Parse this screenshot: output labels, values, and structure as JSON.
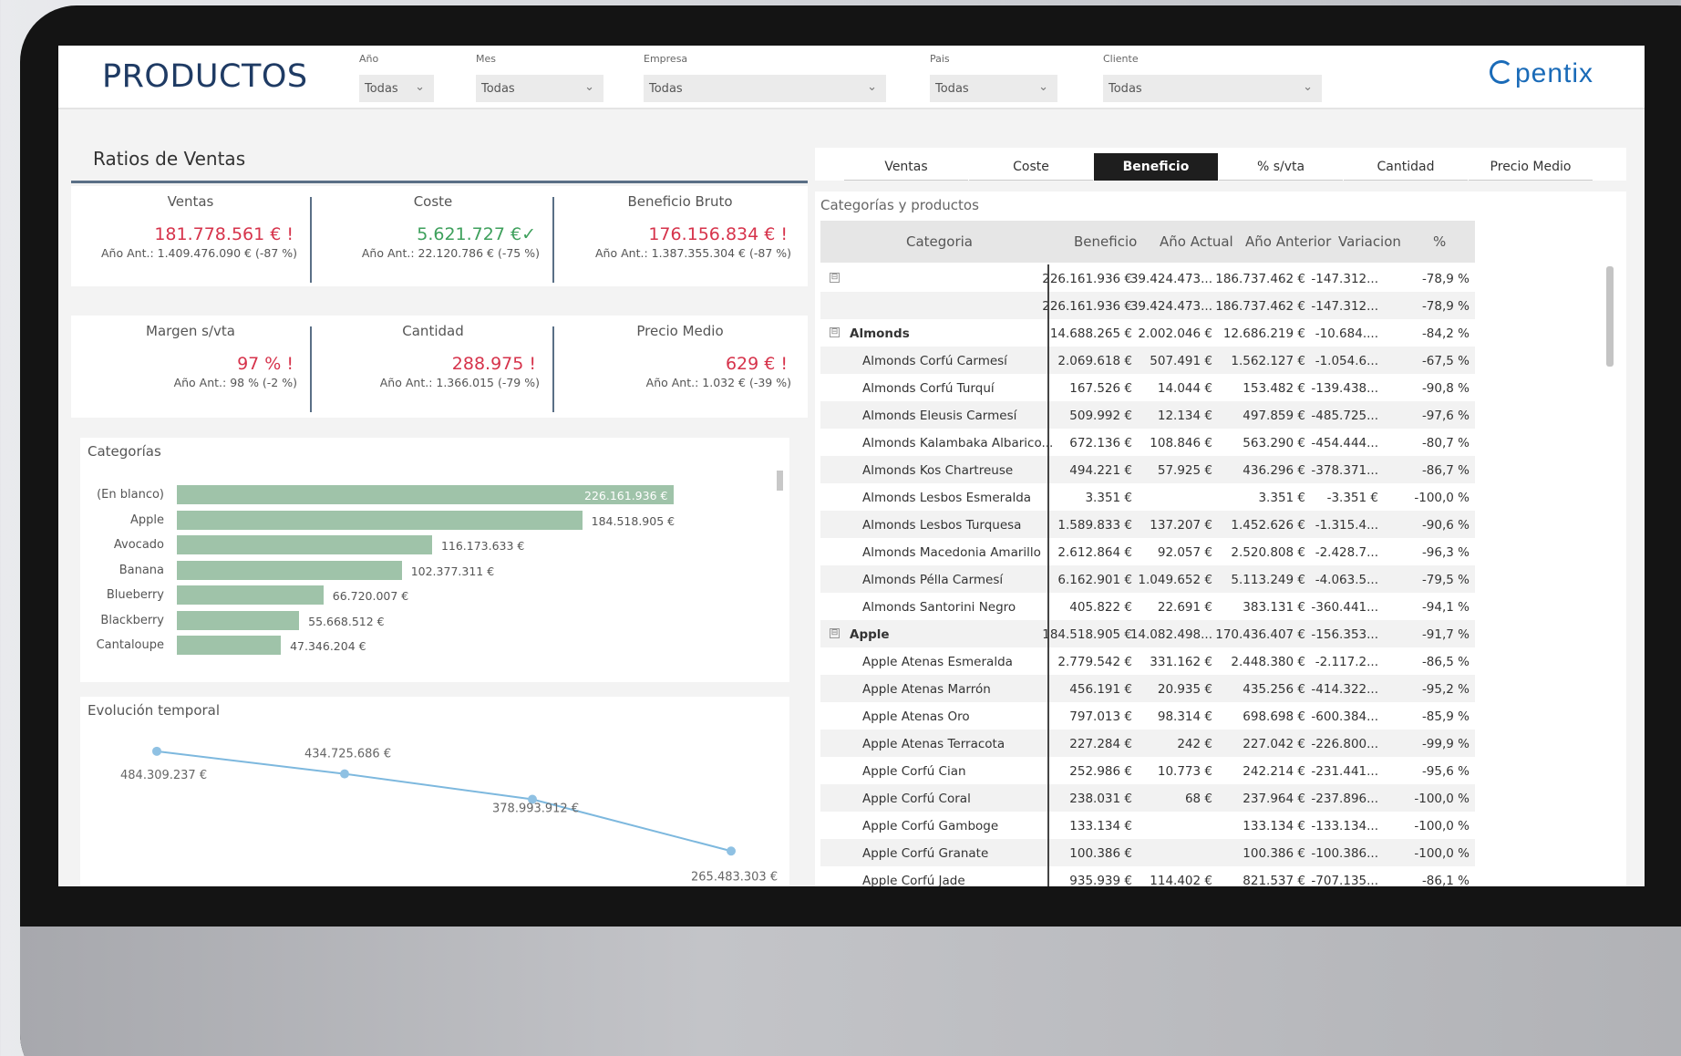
{
  "header": {
    "title": "PRODUCTOS",
    "logo_text": "pentix",
    "filters": [
      {
        "label": "Año",
        "value": "Todas"
      },
      {
        "label": "Mes",
        "value": "Todas"
      },
      {
        "label": "Empresa",
        "value": "Todas"
      },
      {
        "label": "Pais",
        "value": "Todas"
      },
      {
        "label": "Cliente",
        "value": "Todas"
      }
    ]
  },
  "ratios": {
    "title": "Ratios de Ventas",
    "row1": [
      {
        "label": "Ventas",
        "value": "181.778.561 € !",
        "sub": "Año Ant.: 1.409.476.090 € (-87 %)",
        "status": "red"
      },
      {
        "label": "Coste",
        "value": "5.621.727 €✓",
        "sub": "Año Ant.: 22.120.786 € (-75 %)",
        "status": "green"
      },
      {
        "label": "Beneficio Bruto",
        "value": "176.156.834 € !",
        "sub": "Año Ant.: 1.387.355.304 € (-87 %)",
        "status": "red"
      }
    ],
    "row2": [
      {
        "label": "Margen s/vta",
        "value": "97 % !",
        "sub": "Año Ant.: 98 % (-2 %)",
        "status": "red"
      },
      {
        "label": "Cantidad",
        "value": "288.975 !",
        "sub": "Año Ant.: 1.366.015 (-79 %)",
        "status": "red"
      },
      {
        "label": "Precio Medio",
        "value": "629 € !",
        "sub": "Año Ant.: 1.032 € (-39 %)",
        "status": "red"
      }
    ]
  },
  "categorias_card": {
    "title": "Categorías"
  },
  "evolucion_card": {
    "title": "Evolución temporal"
  },
  "chart_data": [
    {
      "type": "bar",
      "title": "Categorías",
      "orientation": "horizontal",
      "categories": [
        "(En blanco)",
        "Apple",
        "Avocado",
        "Banana",
        "Blueberry",
        "Blackberry",
        "Cantaloupe"
      ],
      "values": [
        226161936,
        184518905,
        116173633,
        102377311,
        66720007,
        55668512,
        47346204
      ],
      "labels": [
        "226.161.936 €",
        "184.518.905 €",
        "116.173.633 €",
        "102.377.311 €",
        "66.720.007 €",
        "55.668.512 €",
        "47.346.204 €"
      ],
      "color": "#9fc3a9"
    },
    {
      "type": "line",
      "title": "Evolución temporal",
      "values": [
        484309237,
        434725686,
        378993912,
        265483303
      ],
      "labels": [
        "484.309.237 €",
        "434.725.686 €",
        "378.993.912 €",
        "265.483.303 €"
      ],
      "color": "#7db8de"
    }
  ],
  "tabs": [
    "Ventas",
    "Coste",
    "Beneficio",
    "% s/vta",
    "Cantidad",
    "Precio Medio"
  ],
  "active_tab": "Beneficio",
  "table": {
    "title": "Categorías y productos",
    "columns": [
      "Categoria",
      "Beneficio",
      "Año Actual",
      "Año Anterior",
      "Variacion",
      "%"
    ],
    "rows": [
      {
        "name": "",
        "level": 0,
        "expander": "⊟",
        "cells": [
          "226.161.936 €",
          "39.424.473...",
          "186.737.462 €",
          "-147.312...",
          "-78,9 %"
        ]
      },
      {
        "name": "",
        "level": 1,
        "cells": [
          "226.161.936 €",
          "39.424.473...",
          "186.737.462 €",
          "-147.312...",
          "-78,9 %"
        ]
      },
      {
        "name": "Almonds",
        "level": 0,
        "expander": "⊟",
        "bold": true,
        "cells": [
          "14.688.265 €",
          "2.002.046 €",
          "12.686.219 €",
          "-10.684....",
          "-84,2 %"
        ]
      },
      {
        "name": "Almonds Corfú Carmesí",
        "level": 1,
        "cells": [
          "2.069.618 €",
          "507.491 €",
          "1.562.127 €",
          "-1.054.6...",
          "-67,5 %"
        ]
      },
      {
        "name": "Almonds Corfú Turquí",
        "level": 1,
        "cells": [
          "167.526 €",
          "14.044 €",
          "153.482 €",
          "-139.438...",
          "-90,8 %"
        ]
      },
      {
        "name": "Almonds Eleusis Carmesí",
        "level": 1,
        "cells": [
          "509.992 €",
          "12.134 €",
          "497.859 €",
          "-485.725...",
          "-97,6 %"
        ]
      },
      {
        "name": "Almonds Kalambaka Albarico...",
        "level": 1,
        "cells": [
          "672.136 €",
          "108.846 €",
          "563.290 €",
          "-454.444...",
          "-80,7 %"
        ]
      },
      {
        "name": "Almonds Kos Chartreuse",
        "level": 1,
        "cells": [
          "494.221 €",
          "57.925 €",
          "436.296 €",
          "-378.371...",
          "-86,7 %"
        ]
      },
      {
        "name": "Almonds Lesbos Esmeralda",
        "level": 1,
        "cells": [
          "3.351 €",
          "",
          "3.351 €",
          "-3.351 €",
          "-100,0 %"
        ]
      },
      {
        "name": "Almonds Lesbos Turquesa",
        "level": 1,
        "cells": [
          "1.589.833 €",
          "137.207 €",
          "1.452.626 €",
          "-1.315.4...",
          "-90,6 %"
        ]
      },
      {
        "name": "Almonds Macedonia Amarillo",
        "level": 1,
        "cells": [
          "2.612.864 €",
          "92.057 €",
          "2.520.808 €",
          "-2.428.7...",
          "-96,3 %"
        ]
      },
      {
        "name": "Almonds Pélla Carmesí",
        "level": 1,
        "cells": [
          "6.162.901 €",
          "1.049.652 €",
          "5.113.249 €",
          "-4.063.5...",
          "-79,5 %"
        ]
      },
      {
        "name": "Almonds Santorini Negro",
        "level": 1,
        "cells": [
          "405.822 €",
          "22.691 €",
          "383.131 €",
          "-360.441...",
          "-94,1 %"
        ]
      },
      {
        "name": "Apple",
        "level": 0,
        "expander": "⊟",
        "bold": true,
        "cells": [
          "184.518.905 €",
          "14.082.498...",
          "170.436.407 €",
          "-156.353...",
          "-91,7 %"
        ]
      },
      {
        "name": "Apple Atenas Esmeralda",
        "level": 1,
        "cells": [
          "2.779.542 €",
          "331.162 €",
          "2.448.380 €",
          "-2.117.2...",
          "-86,5 %"
        ]
      },
      {
        "name": "Apple Atenas Marrón",
        "level": 1,
        "cells": [
          "456.191 €",
          "20.935 €",
          "435.256 €",
          "-414.322...",
          "-95,2 %"
        ]
      },
      {
        "name": "Apple Atenas Oro",
        "level": 1,
        "cells": [
          "797.013 €",
          "98.314 €",
          "698.698 €",
          "-600.384...",
          "-85,9 %"
        ]
      },
      {
        "name": "Apple Atenas Terracota",
        "level": 1,
        "cells": [
          "227.284 €",
          "242 €",
          "227.042 €",
          "-226.800...",
          "-99,9 %"
        ]
      },
      {
        "name": "Apple Corfú Cian",
        "level": 1,
        "cells": [
          "252.986 €",
          "10.773 €",
          "242.214 €",
          "-231.441...",
          "-95,6 %"
        ]
      },
      {
        "name": "Apple Corfú Coral",
        "level": 1,
        "cells": [
          "238.031 €",
          "68 €",
          "237.964 €",
          "-237.896...",
          "-100,0 %"
        ]
      },
      {
        "name": "Apple Corfú Gamboge",
        "level": 1,
        "cells": [
          "133.134 €",
          "",
          "133.134 €",
          "-133.134...",
          "-100,0 %"
        ]
      },
      {
        "name": "Apple Corfú Granate",
        "level": 1,
        "cells": [
          "100.386 €",
          "",
          "100.386 €",
          "-100.386...",
          "-100,0 %"
        ]
      },
      {
        "name": "Apple Corfú Jade",
        "level": 1,
        "cells": [
          "935.939 €",
          "114.402 €",
          "821.537 €",
          "-707.135...",
          "-86,1 %"
        ]
      }
    ]
  }
}
